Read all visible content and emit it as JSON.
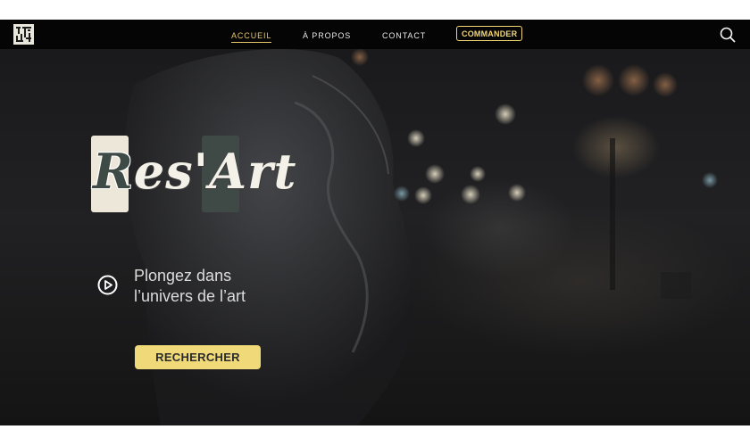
{
  "nav": {
    "logo_icon": "restart-logo-icon",
    "links": [
      {
        "label": "ACCUEIL",
        "active": true
      },
      {
        "label": "À PROPOS",
        "active": false
      },
      {
        "label": "CONTACT",
        "active": false
      }
    ],
    "cta_label": "COMMANDER",
    "search_icon": "search-icon"
  },
  "hero": {
    "brand_part1": "R",
    "brand_part2": "es'",
    "brand_part3": "A",
    "brand_part4": "rt",
    "play_icon": "play-circle-icon",
    "tagline_line1": "Plongez dans",
    "tagline_line2": "l’univers de l’art",
    "search_button_label": "RECHERCHER",
    "scroll_icon": "arrow-down-circle-icon"
  },
  "colors": {
    "accent": "#f0d978",
    "nav_bg": "#050505",
    "active_link": "#e6c66a"
  }
}
